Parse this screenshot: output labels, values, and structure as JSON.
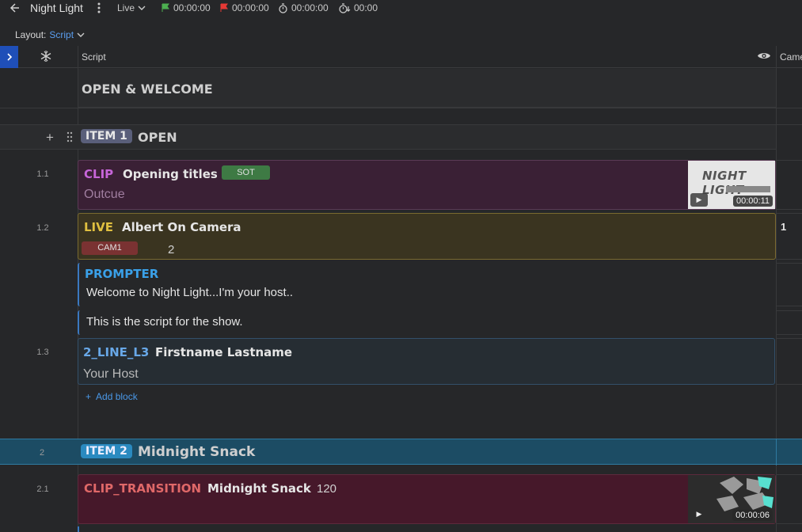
{
  "topbar": {
    "back_icon": "arrow-left-icon",
    "title": "Night Light",
    "mode": "Live",
    "start_time": "00:00:00",
    "end_time": "00:00:00",
    "elapsed_time": "00:00:00",
    "timer_value": "00:00"
  },
  "layout": {
    "label": "Layout:",
    "value": "Script"
  },
  "columns": {
    "script": "Script",
    "camera": "Came"
  },
  "segment": {
    "title": "OPEN & WELCOME"
  },
  "item1": {
    "badge": "ITEM 1",
    "title": "OPEN",
    "rows": [
      {
        "num": "1.1",
        "type": "CLIP",
        "title": "Opening titles",
        "tag": "SOT",
        "sub": "Outcue",
        "thumb_text": "NIGHT LIGHT",
        "duration": "00:00:11"
      },
      {
        "num": "1.2",
        "type": "LIVE",
        "title": "Albert On Camera",
        "chip": "CAM1",
        "chip_value": "2",
        "camera": "1"
      },
      {
        "type": "PROMPTER",
        "line1": "Welcome to Night Light...I'm your host..",
        "line2": "This is the script for the show."
      },
      {
        "num": "1.3",
        "type": "2_LINE_L3",
        "title": "Firstname Lastname",
        "sub": "Your Host"
      }
    ],
    "add_block": "Add block"
  },
  "item2": {
    "num": "2",
    "badge": "ITEM 2",
    "title": "Midnight Snack",
    "rows": [
      {
        "num": "2.1",
        "type": "CLIP_TRANSITION",
        "title": "Midnight Snack",
        "value": "120",
        "duration": "00:00:06"
      }
    ]
  },
  "colors": {
    "clip_type": "#c765d9",
    "live_type": "#e0c040",
    "prompter_type": "#3aa0e8",
    "l3_type": "#68a8e8",
    "transition_type": "#e06868",
    "accent": "#1f4fb8"
  }
}
